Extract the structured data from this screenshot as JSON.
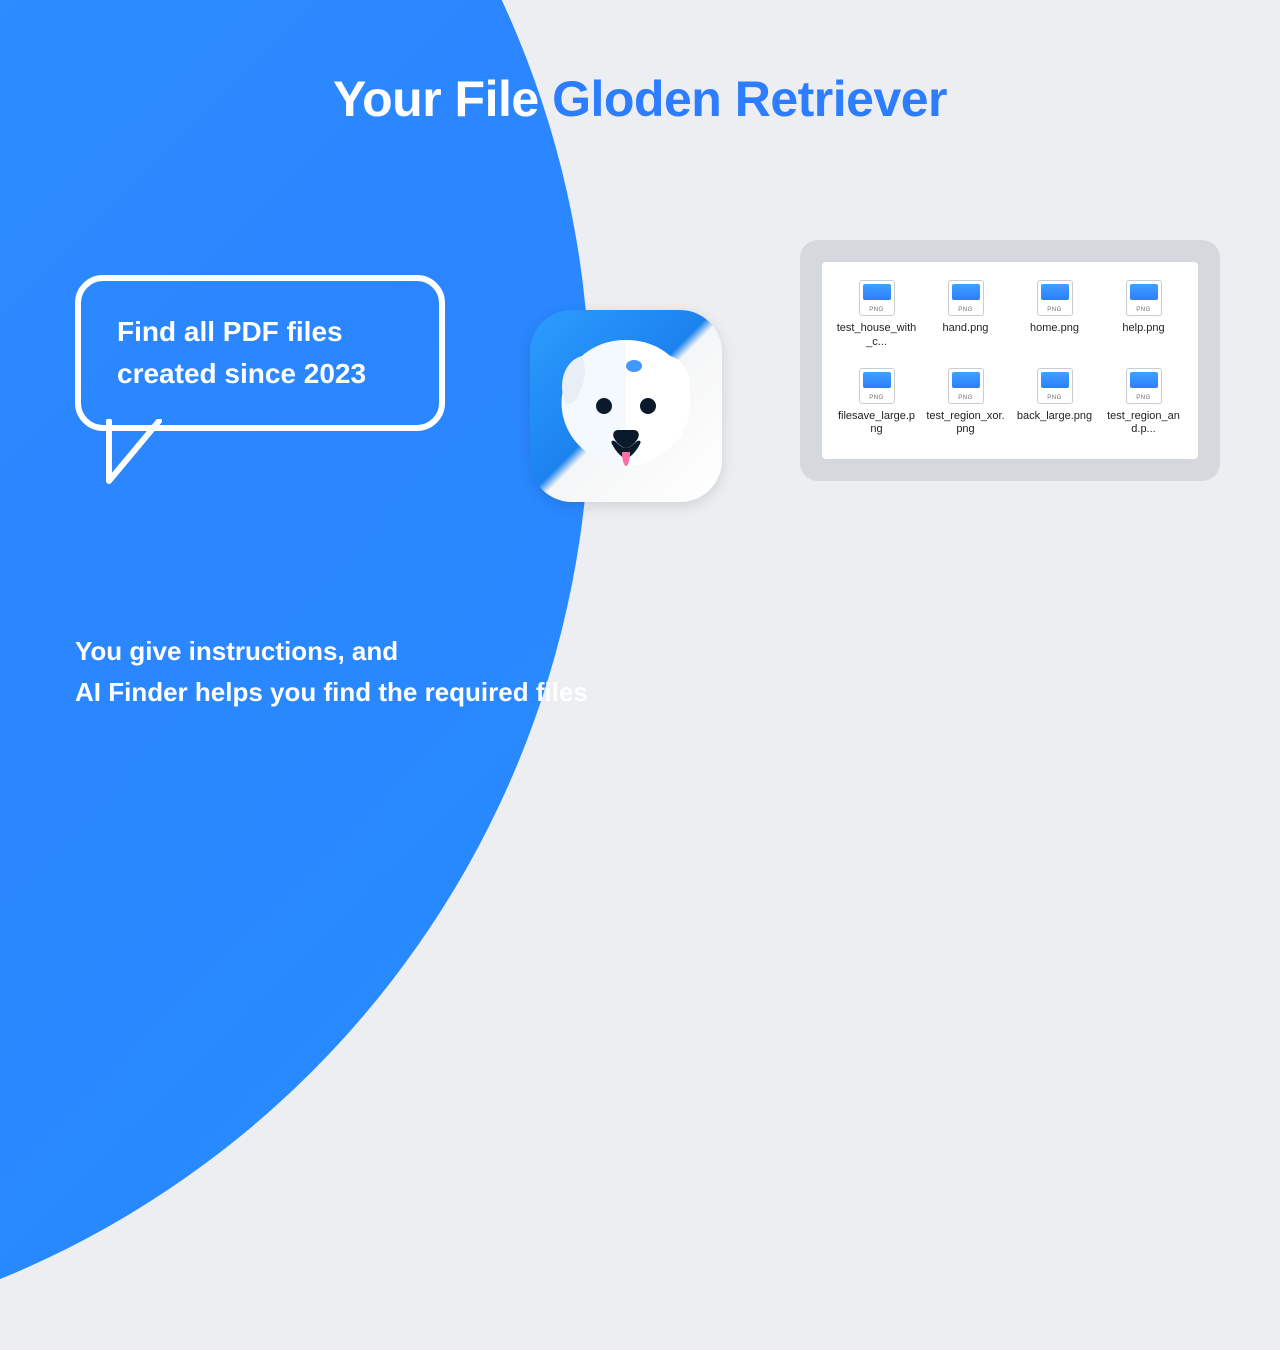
{
  "headline": {
    "part1": "Your File",
    "part2": "Gloden Retriever"
  },
  "bubble_text": "Find all PDF files created since 2023",
  "subtitle_line1": "You give instructions, and",
  "subtitle_line2": "AI Finder helps you find the required files",
  "app_icon": "dog-icon",
  "files": [
    {
      "name": "test_house_with_c..."
    },
    {
      "name": "hand.png"
    },
    {
      "name": "home.png"
    },
    {
      "name": "help.png"
    },
    {
      "name": "filesave_large.png"
    },
    {
      "name": "test_region_xor.png"
    },
    {
      "name": "back_large.png"
    },
    {
      "name": "test_region_and.p..."
    }
  ],
  "colors": {
    "accent_blue": "#2c7dff",
    "gradient_from": "#1fa8ff",
    "gradient_to": "#268cff",
    "panel_bg": "#d5d9de",
    "page_bg": "#eceef1"
  }
}
